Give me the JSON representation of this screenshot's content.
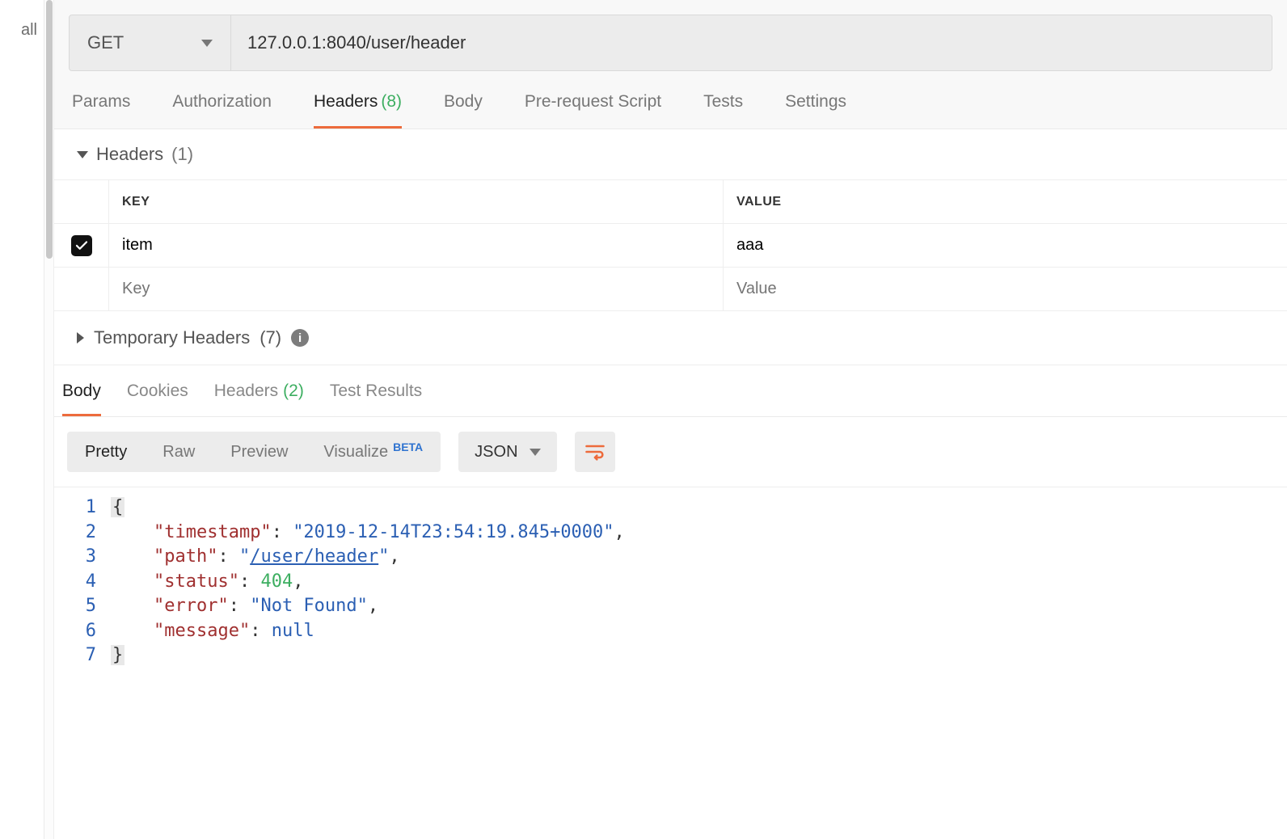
{
  "sidebar": {
    "peek_text": "all"
  },
  "request": {
    "method": "GET",
    "url": "127.0.0.1:8040/user/header",
    "tabs": [
      {
        "label": "Params"
      },
      {
        "label": "Authorization"
      },
      {
        "label": "Headers",
        "count": "(8)",
        "active": true
      },
      {
        "label": "Body"
      },
      {
        "label": "Pre-request Script"
      },
      {
        "label": "Tests"
      },
      {
        "label": "Settings"
      }
    ]
  },
  "headers_section": {
    "title": "Headers",
    "count": "(1)",
    "columns": {
      "key": "KEY",
      "value": "VALUE"
    },
    "rows": [
      {
        "checked": true,
        "key": "item",
        "value": "aaa"
      }
    ],
    "placeholder_key": "Key",
    "placeholder_value": "Value"
  },
  "temp_headers": {
    "title": "Temporary Headers",
    "count": "(7)"
  },
  "response": {
    "tabs": [
      {
        "label": "Body",
        "active": true
      },
      {
        "label": "Cookies"
      },
      {
        "label": "Headers",
        "count": "(2)"
      },
      {
        "label": "Test Results"
      }
    ],
    "view_modes": [
      {
        "label": "Pretty",
        "active": true
      },
      {
        "label": "Raw"
      },
      {
        "label": "Preview"
      },
      {
        "label": "Visualize",
        "beta": "BETA"
      }
    ],
    "format": "JSON",
    "body": {
      "timestamp": "2019-12-14T23:54:19.845+0000",
      "path": "/user/header",
      "status": 404,
      "error": "Not Found",
      "message": null
    },
    "line_numbers": [
      "1",
      "2",
      "3",
      "4",
      "5",
      "6",
      "7"
    ]
  }
}
